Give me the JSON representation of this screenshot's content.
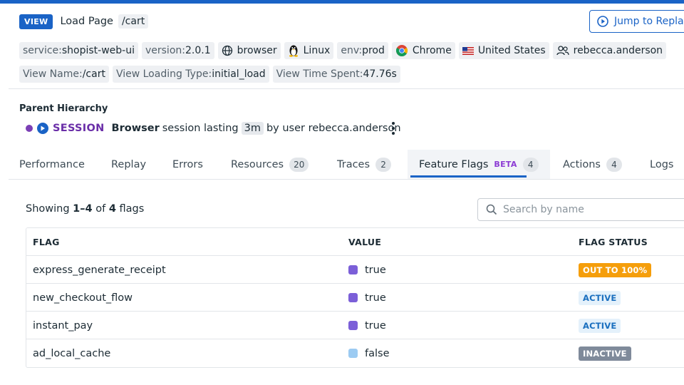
{
  "view": {
    "badge": "VIEW",
    "title": "Load Page",
    "path": "/cart",
    "jump_label": "Jump to Replay"
  },
  "tags_row1": [
    {
      "key": "service:",
      "value": "shopist-web-ui",
      "icon": ""
    },
    {
      "key": "version:",
      "value": "2.0.1",
      "icon": ""
    },
    {
      "key": "",
      "value": "browser",
      "icon": "globe-icon"
    },
    {
      "key": "",
      "value": "Linux",
      "icon": "linux-penguin-icon"
    },
    {
      "key": "env:",
      "value": "prod",
      "icon": ""
    },
    {
      "key": "",
      "value": "Chrome",
      "icon": "chrome-icon"
    },
    {
      "key": "",
      "value": "United States",
      "icon": "us-flag-icon"
    },
    {
      "key": "",
      "value": "rebecca.anderson",
      "icon": "users-icon"
    }
  ],
  "tags_row2": [
    {
      "key": "View Name:",
      "value": "/cart"
    },
    {
      "key": "View Loading Type:",
      "value": "initial_load"
    },
    {
      "key": "View Time Spent:",
      "value": "47.76s"
    }
  ],
  "hierarchy": {
    "title": "Parent Hierarchy",
    "session_label": "SESSION",
    "kind": "Browser",
    "text1": "session lasting",
    "duration": "3m",
    "text2": "by user rebecca.anderson"
  },
  "tabs": [
    {
      "label": "Performance",
      "count": ""
    },
    {
      "label": "Replay",
      "count": ""
    },
    {
      "label": "Errors",
      "count": ""
    },
    {
      "label": "Resources",
      "count": "20"
    },
    {
      "label": "Traces",
      "count": "2"
    },
    {
      "label": "Feature Flags",
      "count": "4",
      "beta": "BETA",
      "active": true
    },
    {
      "label": "Actions",
      "count": "4"
    },
    {
      "label": "Logs",
      "count": ""
    }
  ],
  "summary": {
    "prefix": "Showing",
    "range": "1–4",
    "of": "of",
    "total": "4",
    "suffix": "flags"
  },
  "search": {
    "placeholder": "Search by name"
  },
  "table": {
    "headers": [
      "FLAG",
      "VALUE",
      "FLAG STATUS"
    ],
    "rows": [
      {
        "flag": "express_generate_receipt",
        "value": "true",
        "status": "OUT TO 100%",
        "status_kind": "out",
        "swatch": "#7b5fd8"
      },
      {
        "flag": "new_checkout_flow",
        "value": "true",
        "status": "ACTIVE",
        "status_kind": "active",
        "swatch": "#7b5fd8"
      },
      {
        "flag": "instant_pay",
        "value": "true",
        "status": "ACTIVE",
        "status_kind": "active",
        "swatch": "#7b5fd8"
      },
      {
        "flag": "ad_local_cache",
        "value": "false",
        "status": "INACTIVE",
        "status_kind": "inactive",
        "swatch": "#9ccbf2"
      }
    ]
  },
  "colors": {
    "accent": "#1a63c6",
    "session_purple": "#7b3fb5",
    "out_orange": "#f59e0b"
  }
}
